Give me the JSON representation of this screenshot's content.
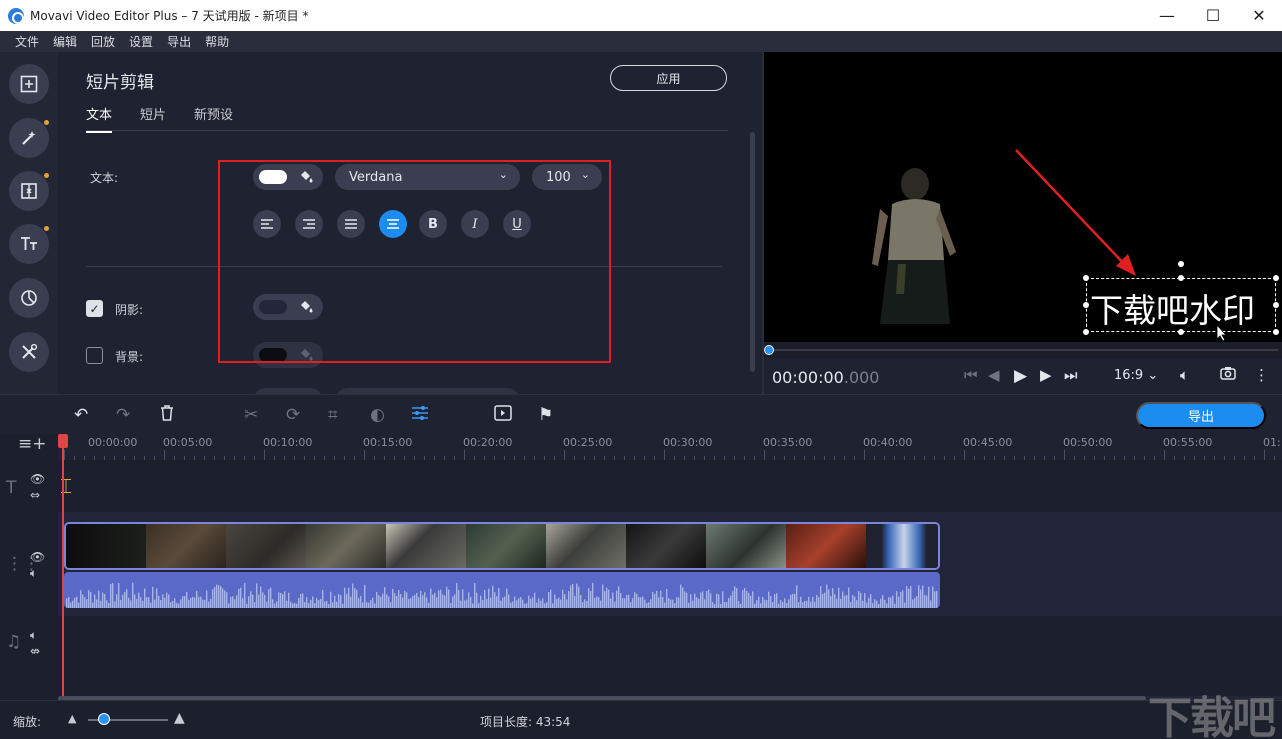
{
  "window": {
    "title": "Movavi Video Editor Plus – 7 天试用版 - 新项目 *",
    "minimize": "—",
    "maximize": "☐",
    "close": "✕"
  },
  "menu": [
    "文件",
    "编辑",
    "回放",
    "设置",
    "导出",
    "帮助"
  ],
  "panel": {
    "title": "短片剪辑",
    "apply": "应用",
    "tabs": [
      "文本",
      "短片",
      "新预设"
    ],
    "text_label": "文本:",
    "font": "Verdana",
    "size": "100",
    "shadow_label": "阴影:",
    "shadow_checked": true,
    "background_label": "背景:",
    "background_checked": false,
    "text_color": "#ffffff",
    "shadow_color": "#2a2d3c",
    "bg_color": "#000000"
  },
  "format_buttons": [
    "align-left-icon",
    "align-right-icon",
    "align-justify-icon",
    "align-center-icon",
    "bold-icon",
    "italic-icon",
    "underline-icon"
  ],
  "preview": {
    "watermark_text": "下载吧水印",
    "time_main": "00:00:00",
    "time_ms": ".000",
    "aspect": "16:9 ⌄"
  },
  "timeline": {
    "export": "导出",
    "ticks": [
      "00:00:00",
      "00:05:00",
      "00:10:00",
      "00:15:00",
      "00:20:00",
      "00:25:00",
      "00:30:00",
      "00:35:00",
      "00:40:00",
      "00:45:00",
      "00:50:00",
      "00:55:00",
      "01:"
    ]
  },
  "bottom": {
    "zoom_label": "缩放:",
    "project_length": "项目长度:  43:54",
    "zoom_level": 0.2
  },
  "site_watermark": "下载吧",
  "colors": {
    "accent": "#1d8cf0",
    "highlight_box": "#e02020",
    "audio": "#5a68c8"
  }
}
